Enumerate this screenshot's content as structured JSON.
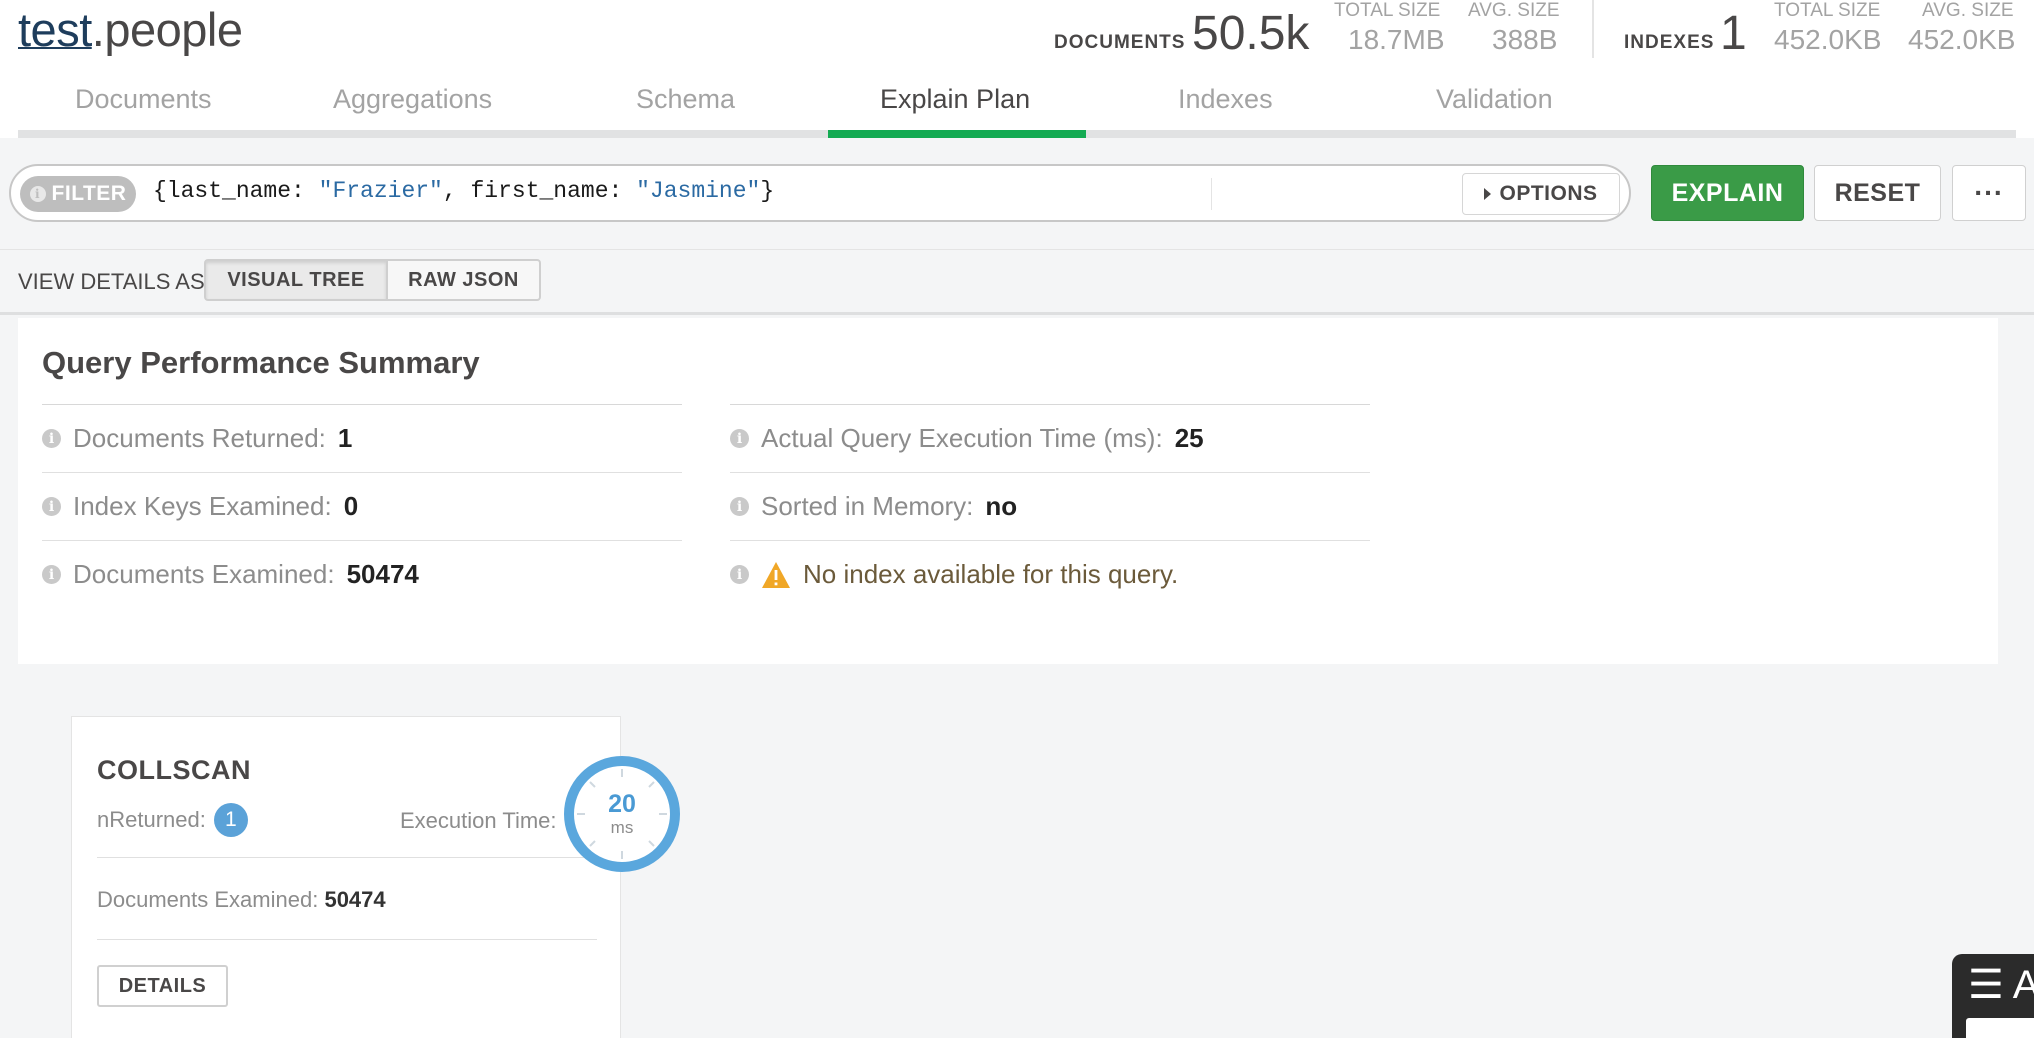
{
  "namespace": {
    "db": "test",
    "collection": ".people"
  },
  "stats": {
    "documents_label": "DOCUMENTS",
    "documents_value": "50.5k",
    "doc_total_size_label": "TOTAL SIZE",
    "doc_total_size_value": "18.7MB",
    "doc_avg_size_label": "AVG. SIZE",
    "doc_avg_size_value": "388B",
    "indexes_label": "INDEXES",
    "indexes_value": "1",
    "idx_total_size_label": "TOTAL SIZE",
    "idx_total_size_value": "452.0KB",
    "idx_avg_size_label": "AVG. SIZE",
    "idx_avg_size_value": "452.0KB"
  },
  "tabs": [
    {
      "label": "Documents"
    },
    {
      "label": "Aggregations"
    },
    {
      "label": "Schema"
    },
    {
      "label": "Explain Plan",
      "active": true
    },
    {
      "label": "Indexes"
    },
    {
      "label": "Validation"
    }
  ],
  "querybar": {
    "filter_label": "FILTER",
    "filter_value_parts": [
      "{last_name: ",
      "\"Frazier\"",
      ", first_name: ",
      "\"Jasmine\"",
      "}"
    ],
    "options_label": "OPTIONS",
    "explain_label": "EXPLAIN",
    "reset_label": "RESET",
    "more_label": "···"
  },
  "view_details": {
    "label": "VIEW DETAILS AS",
    "visual_tree": "VISUAL TREE",
    "raw_json": "RAW JSON",
    "selected": "VISUAL TREE"
  },
  "summary": {
    "title": "Query Performance Summary",
    "left": [
      {
        "label": "Documents Returned:",
        "value": "1"
      },
      {
        "label": "Index Keys Examined:",
        "value": "0"
      },
      {
        "label": "Documents Examined:",
        "value": "50474"
      }
    ],
    "right": [
      {
        "label": "Actual Query Execution Time (ms):",
        "value": "25"
      },
      {
        "label": "Sorted in Memory:",
        "value": "no"
      }
    ],
    "warning": "No index available for this query."
  },
  "stage": {
    "name": "COLLSCAN",
    "nreturned_label": "nReturned:",
    "nreturned_value": "1",
    "exec_time_label": "Execution Time:",
    "exec_time_value": "20",
    "exec_time_unit": "ms",
    "docs_examined_label": "Documents Examined:",
    "docs_examined_value": "50474",
    "details_label": "DETAILS"
  },
  "corner_widget": {
    "text": "☰ A"
  },
  "colors": {
    "accent_green": "#13aa52",
    "explain_button": "#3a9b47",
    "badge_blue": "#5ba2d8",
    "warning": "#f0a727"
  }
}
